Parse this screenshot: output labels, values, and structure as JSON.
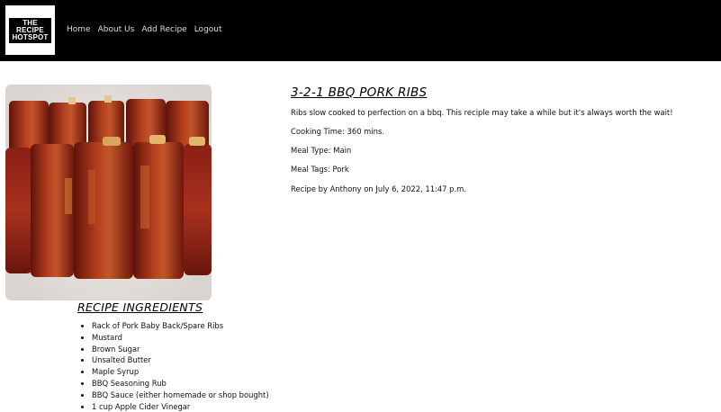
{
  "nav": {
    "logo": {
      "line1": "THE",
      "line2": "RECIPE",
      "line3": "HOTSPOT"
    },
    "links": [
      "Home",
      "About Us",
      "Add Recipe",
      "Logout"
    ]
  },
  "recipe": {
    "title": "3-2-1 BBQ PORK RIBS",
    "description": "Ribs slow cooked to perfection on a bbq. This reciple may take a while but it's always worth the wait!",
    "cooking_time": "Cooking Time: 360 mins.",
    "meal_type": "Meal Type: Main",
    "meal_tags": "Meal Tags: Pork",
    "author_line": "Recipe by Anthony on July 6, 2022, 11:47 p.m."
  },
  "ingredients": {
    "heading": "RECIPE INGREDIENTS",
    "items": [
      "Rack of Pork Baby Back/Spare Ribs",
      "Mustard",
      "Brown Sugar",
      "Unsalted Butter",
      "Maple Syrup",
      "BBQ Seasoning Rub",
      "BBQ Sauce (either homemade or shop bought)",
      "1 cup Apple Cider Vinegar"
    ]
  },
  "colors": {
    "navbar_bg": "#000000",
    "nav_text": "#dcdcdc",
    "page_bg": "#ffffff",
    "logo_accent": "#e53935"
  }
}
